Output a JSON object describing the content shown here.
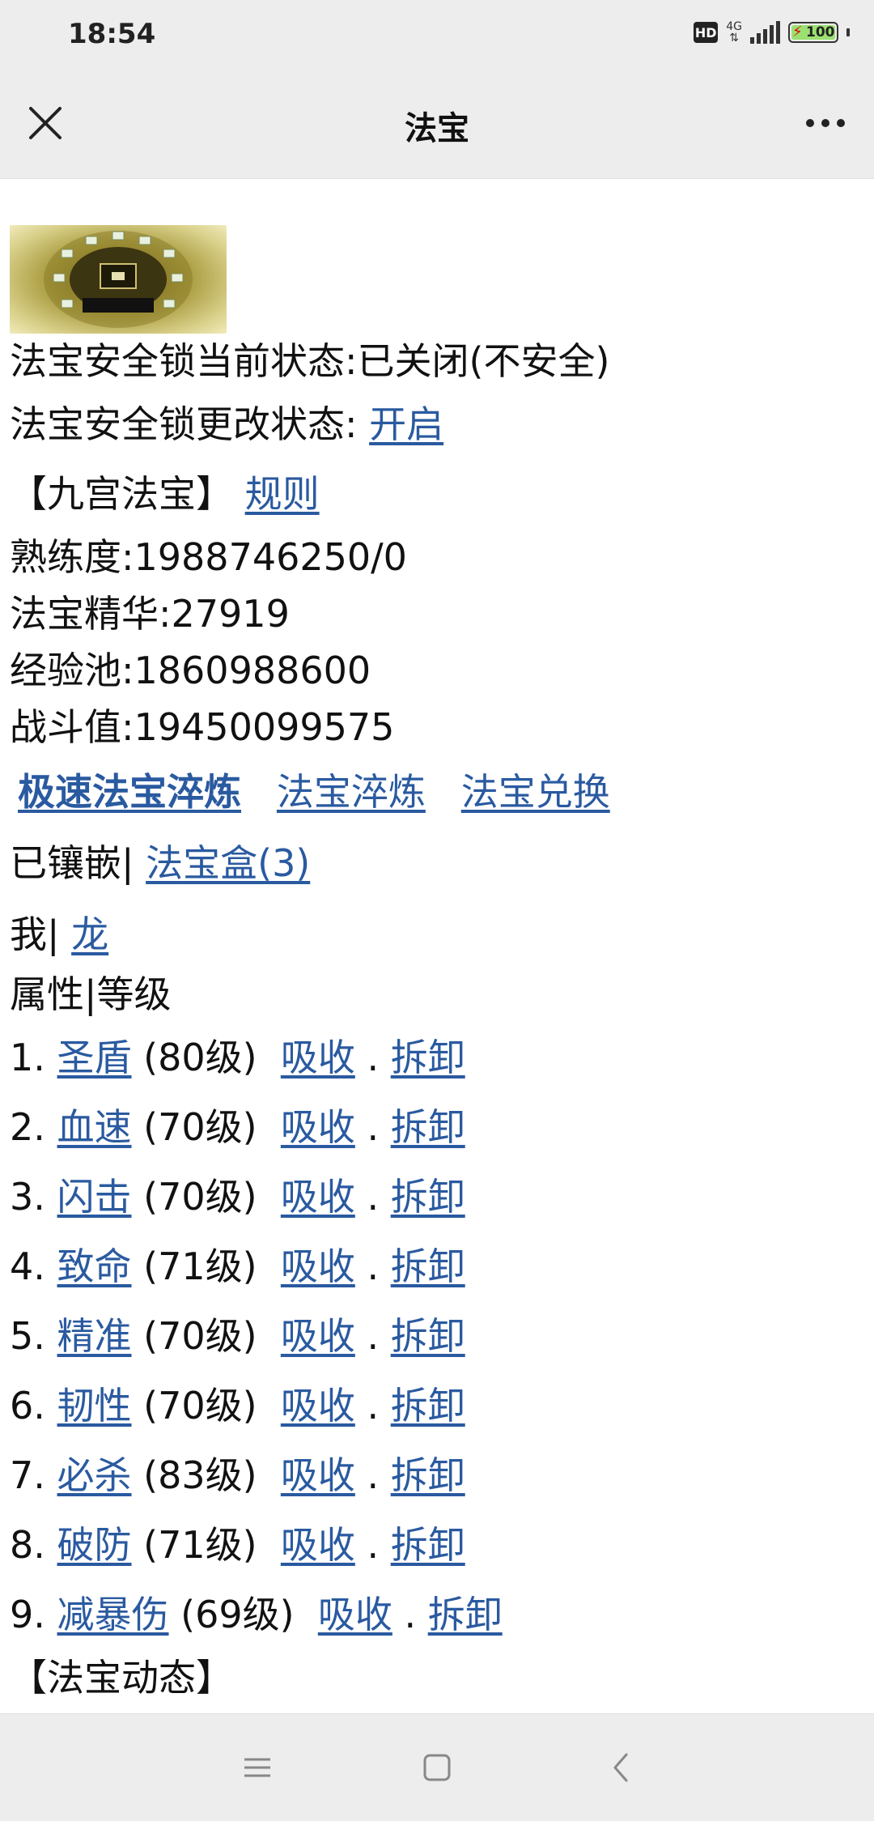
{
  "status_bar": {
    "time": "18:54",
    "hd_label": "HD",
    "network": "4G",
    "battery": "100",
    "icons": [
      "hd-icon",
      "signal-icon",
      "battery-icon"
    ]
  },
  "title_bar": {
    "title": "法宝",
    "icons": [
      "close-icon",
      "more-icon"
    ]
  },
  "main": {
    "lock_status": "法宝安全锁当前状态:已关闭(不安全)",
    "lock_change_label": "法宝安全锁更改状态: ",
    "lock_change_link": "开启",
    "section_title": "【九宫法宝】",
    "rules_link": "规则",
    "proficiency": "熟练度:1988746250/0",
    "essence": "法宝精华:27919",
    "exp_pool": "经验池:1860988600",
    "combat": "战斗值:19450099575",
    "actions": {
      "fast_refine": "极速法宝淬炼",
      "refine": "法宝淬炼",
      "exchange": "法宝兑换"
    },
    "inlaid_label": "已镶嵌|",
    "box_link": "法宝盒(3)",
    "me_label": "我|",
    "dragon_link": "龙",
    "attr_header": "属性|等级",
    "absorb_label": "吸收",
    "dot": ".",
    "remove_label": "拆卸",
    "attributes": [
      {
        "index": "1.",
        "name": "圣盾",
        "level": "(80级)"
      },
      {
        "index": "2.",
        "name": "血速",
        "level": "(70级)"
      },
      {
        "index": "3.",
        "name": "闪击",
        "level": "(70级)"
      },
      {
        "index": "4.",
        "name": "致命",
        "level": "(71级)"
      },
      {
        "index": "5.",
        "name": "精准",
        "level": "(70级)"
      },
      {
        "index": "6.",
        "name": "韧性",
        "level": "(70级)"
      },
      {
        "index": "7.",
        "name": "必杀",
        "level": "(83级)"
      },
      {
        "index": "8.",
        "name": "破防",
        "level": "(71级)"
      },
      {
        "index": "9.",
        "name": "减暴伤",
        "level": "(69级)"
      }
    ],
    "dynamics_title": "【法宝动态】"
  },
  "nav_bar": {
    "icons": [
      "menu-icon",
      "home-square-icon",
      "back-chevron-icon"
    ]
  },
  "colors": {
    "link": "#2a5aa0",
    "bar_bg": "#ededed",
    "text": "#111111"
  }
}
